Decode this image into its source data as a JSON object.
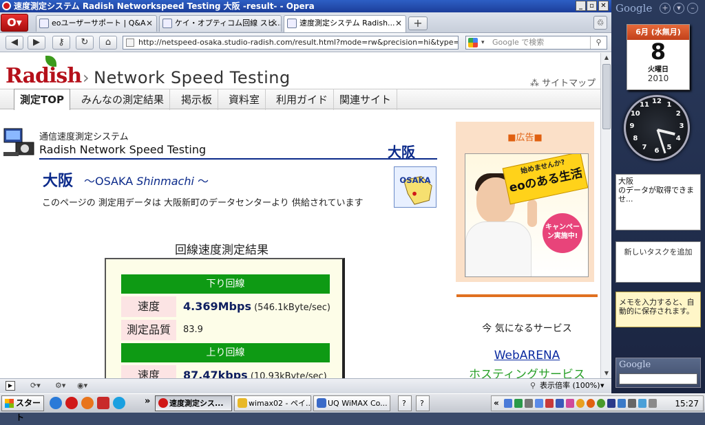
{
  "window": {
    "title": "速度測定システム Radish Networkspeed Testing 大阪 -result- - Opera",
    "controls": [
      "_",
      "▫",
      "✕"
    ]
  },
  "tabs": [
    {
      "label": "eoユーザーサポート | Q&A",
      "close": "✕"
    },
    {
      "label": "ケイ・オプティコム回線 スピ...",
      "close": "✕"
    },
    {
      "label": "速度測定システム Radish...",
      "close": "✕"
    }
  ],
  "toolbar": {
    "new_tab": "+",
    "trash": "♲",
    "back": "◀",
    "forward": "▶",
    "key": "⚷",
    "reload": "↻",
    "home": "⌂",
    "url": "http://netspeed-osaka.studio-radish.com/result.html?mode=rw&precision=hi&type=n&rs=",
    "search_placeholder": "Google で検索",
    "search_dropdown": "▾",
    "search_go": "⚲"
  },
  "site": {
    "logo": "Radish",
    "logo_arrow": "›",
    "title": "Network Speed Testing",
    "sitemap": "サイトマップ",
    "menu": [
      "測定TOP",
      "みんなの測定結果",
      "掲示板",
      "資料室",
      "利用ガイド",
      "関連サイト"
    ]
  },
  "content": {
    "system_name": "通信速度測定システム",
    "system_name_en": "Radish Network Speed Testing",
    "city_tag": "大阪",
    "big_city": "大阪",
    "city_sub_prefix": "〜OSAKA ",
    "city_sub_italic": "Shinmachi",
    "city_sub_suffix": " 〜",
    "map_label": "OSAKA",
    "description": "このページの 測定用データは 大阪新町のデータセンターより 供給されています",
    "result_title": "回線速度測定結果",
    "download": {
      "header": "下り回線",
      "speed_label": "速度",
      "speed_value": "4.369Mbps",
      "speed_detail": " (546.1kByte/sec)",
      "quality_label": "測定品質",
      "quality_value": "83.9"
    },
    "upload": {
      "header": "上り回線",
      "speed_label": "速度",
      "speed_value": "87.47kbps",
      "speed_detail": " (10.93kByte/sec)"
    }
  },
  "ad": {
    "label": "■広告■",
    "banner_small": "始めませんか?",
    "banner_big": "eoのある生活",
    "badge": "キャンペーン実施中!",
    "interest": "今 気になるサービス",
    "link1": "WebARENA",
    "link2": "ホスティングサービス"
  },
  "statusbar": {
    "zoom": "表示倍率 (100%)",
    "zoom_drop": "▾"
  },
  "sidebar": {
    "google": "Google",
    "calendar_month": "6月 (水無月)",
    "calendar_day": "8",
    "calendar_weekday": "火曜日",
    "calendar_year": "2010",
    "clock_numbers": [
      "12",
      "1",
      "2",
      "3",
      "4",
      "5",
      "6",
      "7",
      "8",
      "9",
      "10",
      "11"
    ],
    "clock_hour": 3,
    "clock_minute": 27,
    "weather_city": "大阪",
    "weather_msg": "のデータが取得できませ...",
    "task_add": "新しいタスクを追加",
    "memo": "メモを入力すると、自動的に保存されます。",
    "google_search": "Google"
  },
  "taskbar": {
    "start": "スタート",
    "more": "»",
    "items": [
      {
        "label": "速度測定シス...",
        "active": true
      },
      {
        "label": "wimax02 - ペイ...",
        "active": false
      },
      {
        "label": "UQ WiMAX Co...",
        "active": false
      }
    ],
    "help": "?",
    "tray_expand": "«",
    "clock": "15:27"
  }
}
